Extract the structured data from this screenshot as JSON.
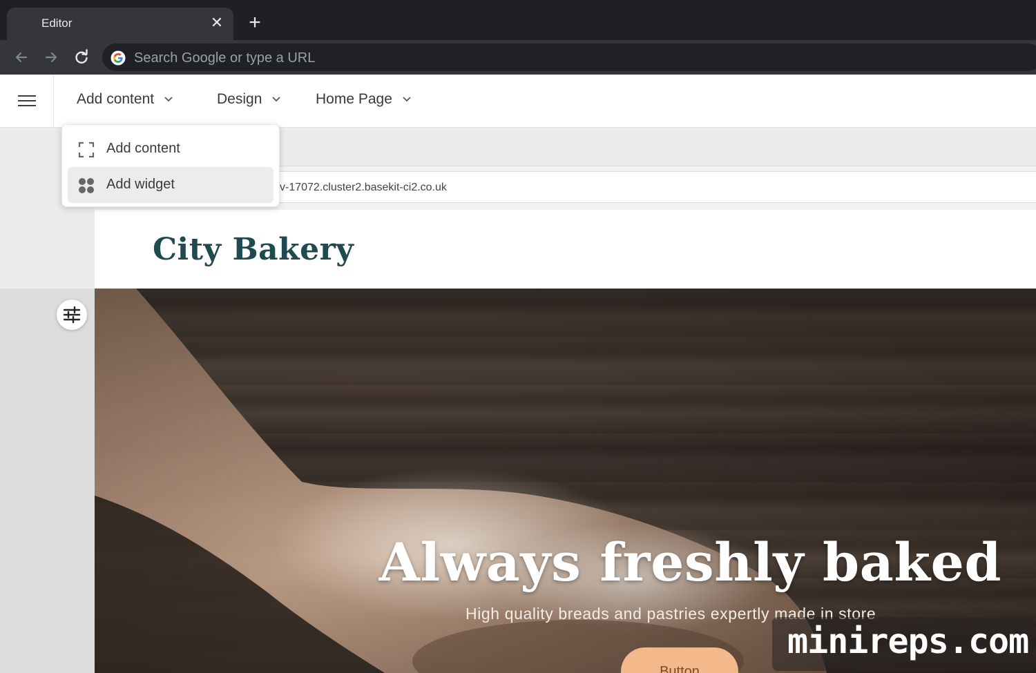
{
  "browser": {
    "tab_title": "Editor",
    "tab_close_glyph": "✕",
    "new_tab_glyph": "+",
    "omnibox_placeholder": "Search Google or type a URL"
  },
  "editor": {
    "menu": {
      "add_content": "Add content",
      "design": "Design",
      "home_page": "Home Page"
    },
    "dropdown": {
      "items": [
        {
          "label": "Add content",
          "icon": "frame-corners-icon"
        },
        {
          "label": "Add widget",
          "icon": "widget-dots-icon",
          "highlighted": true
        }
      ]
    }
  },
  "preview": {
    "url_text": "v-17072.cluster2.basekit-ci2.co.uk",
    "site_title": "City Bakery",
    "hero_title": "Always freshly baked",
    "hero_subtitle": "High quality breads and pastries expertly made in store",
    "hero_button": "Button"
  },
  "watermark": "minireps.com",
  "colors": {
    "site_title": "#1f4b4f",
    "hero_button": "#f3b98a",
    "chrome_dark": "#202124"
  }
}
